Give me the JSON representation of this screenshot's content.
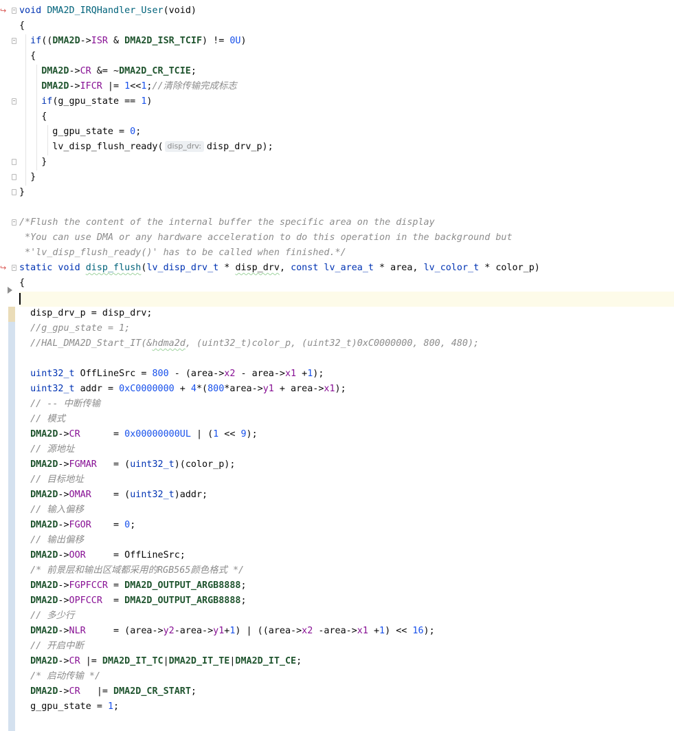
{
  "editor": {
    "lines": [
      {
        "indent": 0,
        "t": [
          [
            "kw",
            "void"
          ],
          [
            "",
            ""
          ],
          [
            "fn",
            "DMA2D_IRQHandler_User"
          ],
          [
            "",
            "(void)"
          ]
        ]
      },
      {
        "indent": 0,
        "t": [
          [
            "",
            "{"
          ]
        ]
      },
      {
        "indent": 2,
        "t": [
          [
            "kw",
            "if"
          ],
          [
            "",
            "(("
          ],
          [
            "mac",
            "DMA2D"
          ],
          [
            "",
            "->"
          ],
          [
            "mb",
            "ISR"
          ],
          [
            "",
            " & "
          ],
          [
            "mac",
            "DMA2D_ISR_TCIF"
          ],
          [
            "",
            ") != "
          ],
          [
            "num",
            "0U"
          ],
          [
            "",
            ")"
          ]
        ]
      },
      {
        "indent": 2,
        "t": [
          [
            "",
            "{"
          ]
        ]
      },
      {
        "indent": 4,
        "t": [
          [
            "mac",
            "DMA2D"
          ],
          [
            "",
            "->"
          ],
          [
            "mb",
            "CR"
          ],
          [
            "",
            " &= ~"
          ],
          [
            "mac",
            "DMA2D_CR_TCIE"
          ],
          [
            "",
            ";"
          ]
        ]
      },
      {
        "indent": 4,
        "t": [
          [
            "mac",
            "DMA2D"
          ],
          [
            "",
            "->"
          ],
          [
            "mb",
            "IFCR"
          ],
          [
            "",
            " |= "
          ],
          [
            "num",
            "1"
          ],
          [
            "",
            "<<"
          ],
          [
            "num",
            "1"
          ],
          [
            "",
            ";"
          ],
          [
            "cm",
            "//清除传输完成标志"
          ]
        ]
      },
      {
        "indent": 4,
        "t": [
          [
            "kw",
            "if"
          ],
          [
            "",
            "(g_gpu_state == "
          ],
          [
            "num",
            "1"
          ],
          [
            "",
            ")"
          ]
        ]
      },
      {
        "indent": 4,
        "t": [
          [
            "",
            "{"
          ]
        ]
      },
      {
        "indent": 6,
        "t": [
          [
            "",
            "g_gpu_state = "
          ],
          [
            "num",
            "0"
          ],
          [
            "",
            ";"
          ]
        ]
      },
      {
        "indent": 6,
        "t": [
          [
            "",
            "lv_disp_flush_ready("
          ],
          [
            "hint",
            "disp_drv:"
          ],
          [
            "",
            "disp_drv_p);"
          ]
        ]
      },
      {
        "indent": 4,
        "t": [
          [
            "",
            "}"
          ]
        ]
      },
      {
        "indent": 2,
        "t": [
          [
            "",
            "}"
          ]
        ]
      },
      {
        "indent": 0,
        "t": [
          [
            "",
            "}"
          ]
        ]
      },
      {
        "indent": 0,
        "t": []
      },
      {
        "indent": 0,
        "t": [
          [
            "cm",
            "/*Flush the content of the internal buffer the specific area on the display"
          ]
        ]
      },
      {
        "indent": 0,
        "t": [
          [
            "cm",
            " *You can use DMA or any hardware acceleration to do this operation in the background but"
          ]
        ]
      },
      {
        "indent": 0,
        "t": [
          [
            "cm",
            " *'lv_disp_flush_ready()' has to be called when finished.*/"
          ]
        ]
      },
      {
        "indent": 0,
        "t": [
          [
            "kw",
            "static void "
          ],
          [
            "fnu",
            "disp_flush"
          ],
          [
            "",
            "("
          ],
          [
            "kw",
            "lv_disp_drv_t"
          ],
          [
            "",
            " * "
          ],
          [
            "u",
            "disp_drv"
          ],
          [
            "",
            ", "
          ],
          [
            "kw",
            "const lv_area_t"
          ],
          [
            "",
            " * area, "
          ],
          [
            "kw",
            "lv_color_t"
          ],
          [
            "",
            " * color_p)"
          ]
        ]
      },
      {
        "indent": 0,
        "t": [
          [
            "",
            "{"
          ]
        ]
      },
      {
        "indent": 0,
        "t": []
      },
      {
        "indent": 2,
        "t": [
          [
            "",
            "disp_drv_p = disp_drv;"
          ]
        ]
      },
      {
        "indent": 2,
        "t": [
          [
            "cm",
            "//g_gpu_state = 1;"
          ]
        ]
      },
      {
        "indent": 2,
        "t": [
          [
            "cm",
            "//HAL_DMA2D_Start_IT(&"
          ],
          [
            "cmu",
            "hdma2d"
          ],
          [
            "cm",
            ", (uint32_t)color_p, (uint32_t)0xC0000000, 800, 480);"
          ]
        ]
      },
      {
        "indent": 0,
        "t": []
      },
      {
        "indent": 2,
        "t": [
          [
            "kw",
            "uint32_t"
          ],
          [
            "",
            " OffLineSrc = "
          ],
          [
            "num",
            "800"
          ],
          [
            "",
            " - (area->"
          ],
          [
            "mb",
            "x2"
          ],
          [
            "",
            " - area->"
          ],
          [
            "mb",
            "x1"
          ],
          [
            "",
            " +"
          ],
          [
            "num",
            "1"
          ],
          [
            "",
            ");"
          ]
        ]
      },
      {
        "indent": 2,
        "t": [
          [
            "kw",
            "uint32_t"
          ],
          [
            "",
            " addr = "
          ],
          [
            "num",
            "0xC0000000"
          ],
          [
            "",
            " + "
          ],
          [
            "num",
            "4"
          ],
          [
            "",
            "*("
          ],
          [
            "num",
            "800"
          ],
          [
            "",
            "*area->"
          ],
          [
            "mb",
            "y1"
          ],
          [
            "",
            " + area->"
          ],
          [
            "mb",
            "x1"
          ],
          [
            "",
            ");"
          ]
        ]
      },
      {
        "indent": 2,
        "t": [
          [
            "cm",
            "// -- 中断传输"
          ]
        ]
      },
      {
        "indent": 2,
        "t": [
          [
            "cm",
            "// 模式"
          ]
        ]
      },
      {
        "indent": 2,
        "t": [
          [
            "mac",
            "DMA2D"
          ],
          [
            "",
            "->"
          ],
          [
            "mb",
            "CR"
          ],
          [
            "",
            "      = "
          ],
          [
            "num",
            "0x00000000UL"
          ],
          [
            "",
            " | ("
          ],
          [
            "num",
            "1"
          ],
          [
            "",
            " << "
          ],
          [
            "num",
            "9"
          ],
          [
            "",
            ");"
          ]
        ]
      },
      {
        "indent": 2,
        "t": [
          [
            "cm",
            "// 源地址"
          ]
        ]
      },
      {
        "indent": 2,
        "t": [
          [
            "mac",
            "DMA2D"
          ],
          [
            "",
            "->"
          ],
          [
            "mb",
            "FGMAR"
          ],
          [
            "",
            "   = ("
          ],
          [
            "kw",
            "uint32_t"
          ],
          [
            "",
            ")(color_p);"
          ]
        ]
      },
      {
        "indent": 2,
        "t": [
          [
            "cm",
            "// 目标地址"
          ]
        ]
      },
      {
        "indent": 2,
        "t": [
          [
            "mac",
            "DMA2D"
          ],
          [
            "",
            "->"
          ],
          [
            "mb",
            "OMAR"
          ],
          [
            "",
            "    = ("
          ],
          [
            "kw",
            "uint32_t"
          ],
          [
            "",
            ")addr;"
          ]
        ]
      },
      {
        "indent": 2,
        "t": [
          [
            "cm",
            "// 输入偏移"
          ]
        ]
      },
      {
        "indent": 2,
        "t": [
          [
            "mac",
            "DMA2D"
          ],
          [
            "",
            "->"
          ],
          [
            "mb",
            "FGOR"
          ],
          [
            "",
            "    = "
          ],
          [
            "num",
            "0"
          ],
          [
            "",
            ";"
          ]
        ]
      },
      {
        "indent": 2,
        "t": [
          [
            "cm",
            "// 输出偏移"
          ]
        ]
      },
      {
        "indent": 2,
        "t": [
          [
            "mac",
            "DMA2D"
          ],
          [
            "",
            "->"
          ],
          [
            "mb",
            "OOR"
          ],
          [
            "",
            "     = OffLineSrc;"
          ]
        ]
      },
      {
        "indent": 2,
        "t": [
          [
            "cm",
            "/* 前景层和输出区域都采用的RGB565颜色格式 */"
          ]
        ]
      },
      {
        "indent": 2,
        "t": [
          [
            "mac",
            "DMA2D"
          ],
          [
            "",
            "->"
          ],
          [
            "mb",
            "FGPFCCR"
          ],
          [
            "",
            " = "
          ],
          [
            "mac",
            "DMA2D_OUTPUT_ARGB8888"
          ],
          [
            "",
            ";"
          ]
        ]
      },
      {
        "indent": 2,
        "t": [
          [
            "mac",
            "DMA2D"
          ],
          [
            "",
            "->"
          ],
          [
            "mb",
            "OPFCCR"
          ],
          [
            "",
            "  = "
          ],
          [
            "mac",
            "DMA2D_OUTPUT_ARGB8888"
          ],
          [
            "",
            ";"
          ]
        ]
      },
      {
        "indent": 2,
        "t": [
          [
            "cm",
            "// 多少行"
          ]
        ]
      },
      {
        "indent": 2,
        "t": [
          [
            "mac",
            "DMA2D"
          ],
          [
            "",
            "->"
          ],
          [
            "mb",
            "NLR"
          ],
          [
            "",
            "     = (area->"
          ],
          [
            "mb",
            "y2"
          ],
          [
            "",
            "-area->"
          ],
          [
            "mb",
            "y1"
          ],
          [
            "",
            "+"
          ],
          [
            "num",
            "1"
          ],
          [
            "",
            ") | ((area->"
          ],
          [
            "mb",
            "x2"
          ],
          [
            "",
            " -area->"
          ],
          [
            "mb",
            "x1"
          ],
          [
            "",
            " +"
          ],
          [
            "num",
            "1"
          ],
          [
            "",
            ") << "
          ],
          [
            "num",
            "16"
          ],
          [
            "",
            ");"
          ]
        ]
      },
      {
        "indent": 2,
        "t": [
          [
            "cm",
            "// 开启中断"
          ]
        ]
      },
      {
        "indent": 2,
        "t": [
          [
            "mac",
            "DMA2D"
          ],
          [
            "",
            "->"
          ],
          [
            "mb",
            "CR"
          ],
          [
            "",
            " |= "
          ],
          [
            "mac",
            "DMA2D_IT_TC"
          ],
          [
            "",
            "|"
          ],
          [
            "mac",
            "DMA2D_IT_TE"
          ],
          [
            "",
            "|"
          ],
          [
            "mac",
            "DMA2D_IT_CE"
          ],
          [
            "",
            ";"
          ]
        ]
      },
      {
        "indent": 2,
        "t": [
          [
            "cm",
            "/* 启动传输 */"
          ]
        ]
      },
      {
        "indent": 2,
        "t": [
          [
            "mac",
            "DMA2D"
          ],
          [
            "",
            "->"
          ],
          [
            "mb",
            "CR"
          ],
          [
            "",
            "   |= "
          ],
          [
            "mac",
            "DMA2D_CR_START"
          ],
          [
            "",
            ";"
          ]
        ]
      },
      {
        "indent": 2,
        "t": [
          [
            "",
            "g_gpu_state = "
          ],
          [
            "num",
            "1"
          ],
          [
            "",
            ";"
          ]
        ]
      }
    ]
  },
  "colors": {
    "keyword": "#0033b3",
    "function": "#00627a",
    "member": "#871094",
    "number": "#1750eb",
    "macro": "#1f542e",
    "comment": "#8c8c8c",
    "current_line": "#fdfbe9",
    "gutter_change": "#d4e1ef"
  },
  "icons": [
    "run-gutter-icon",
    "fold-marker-icon",
    "breakpoint-arrow-icon"
  ]
}
